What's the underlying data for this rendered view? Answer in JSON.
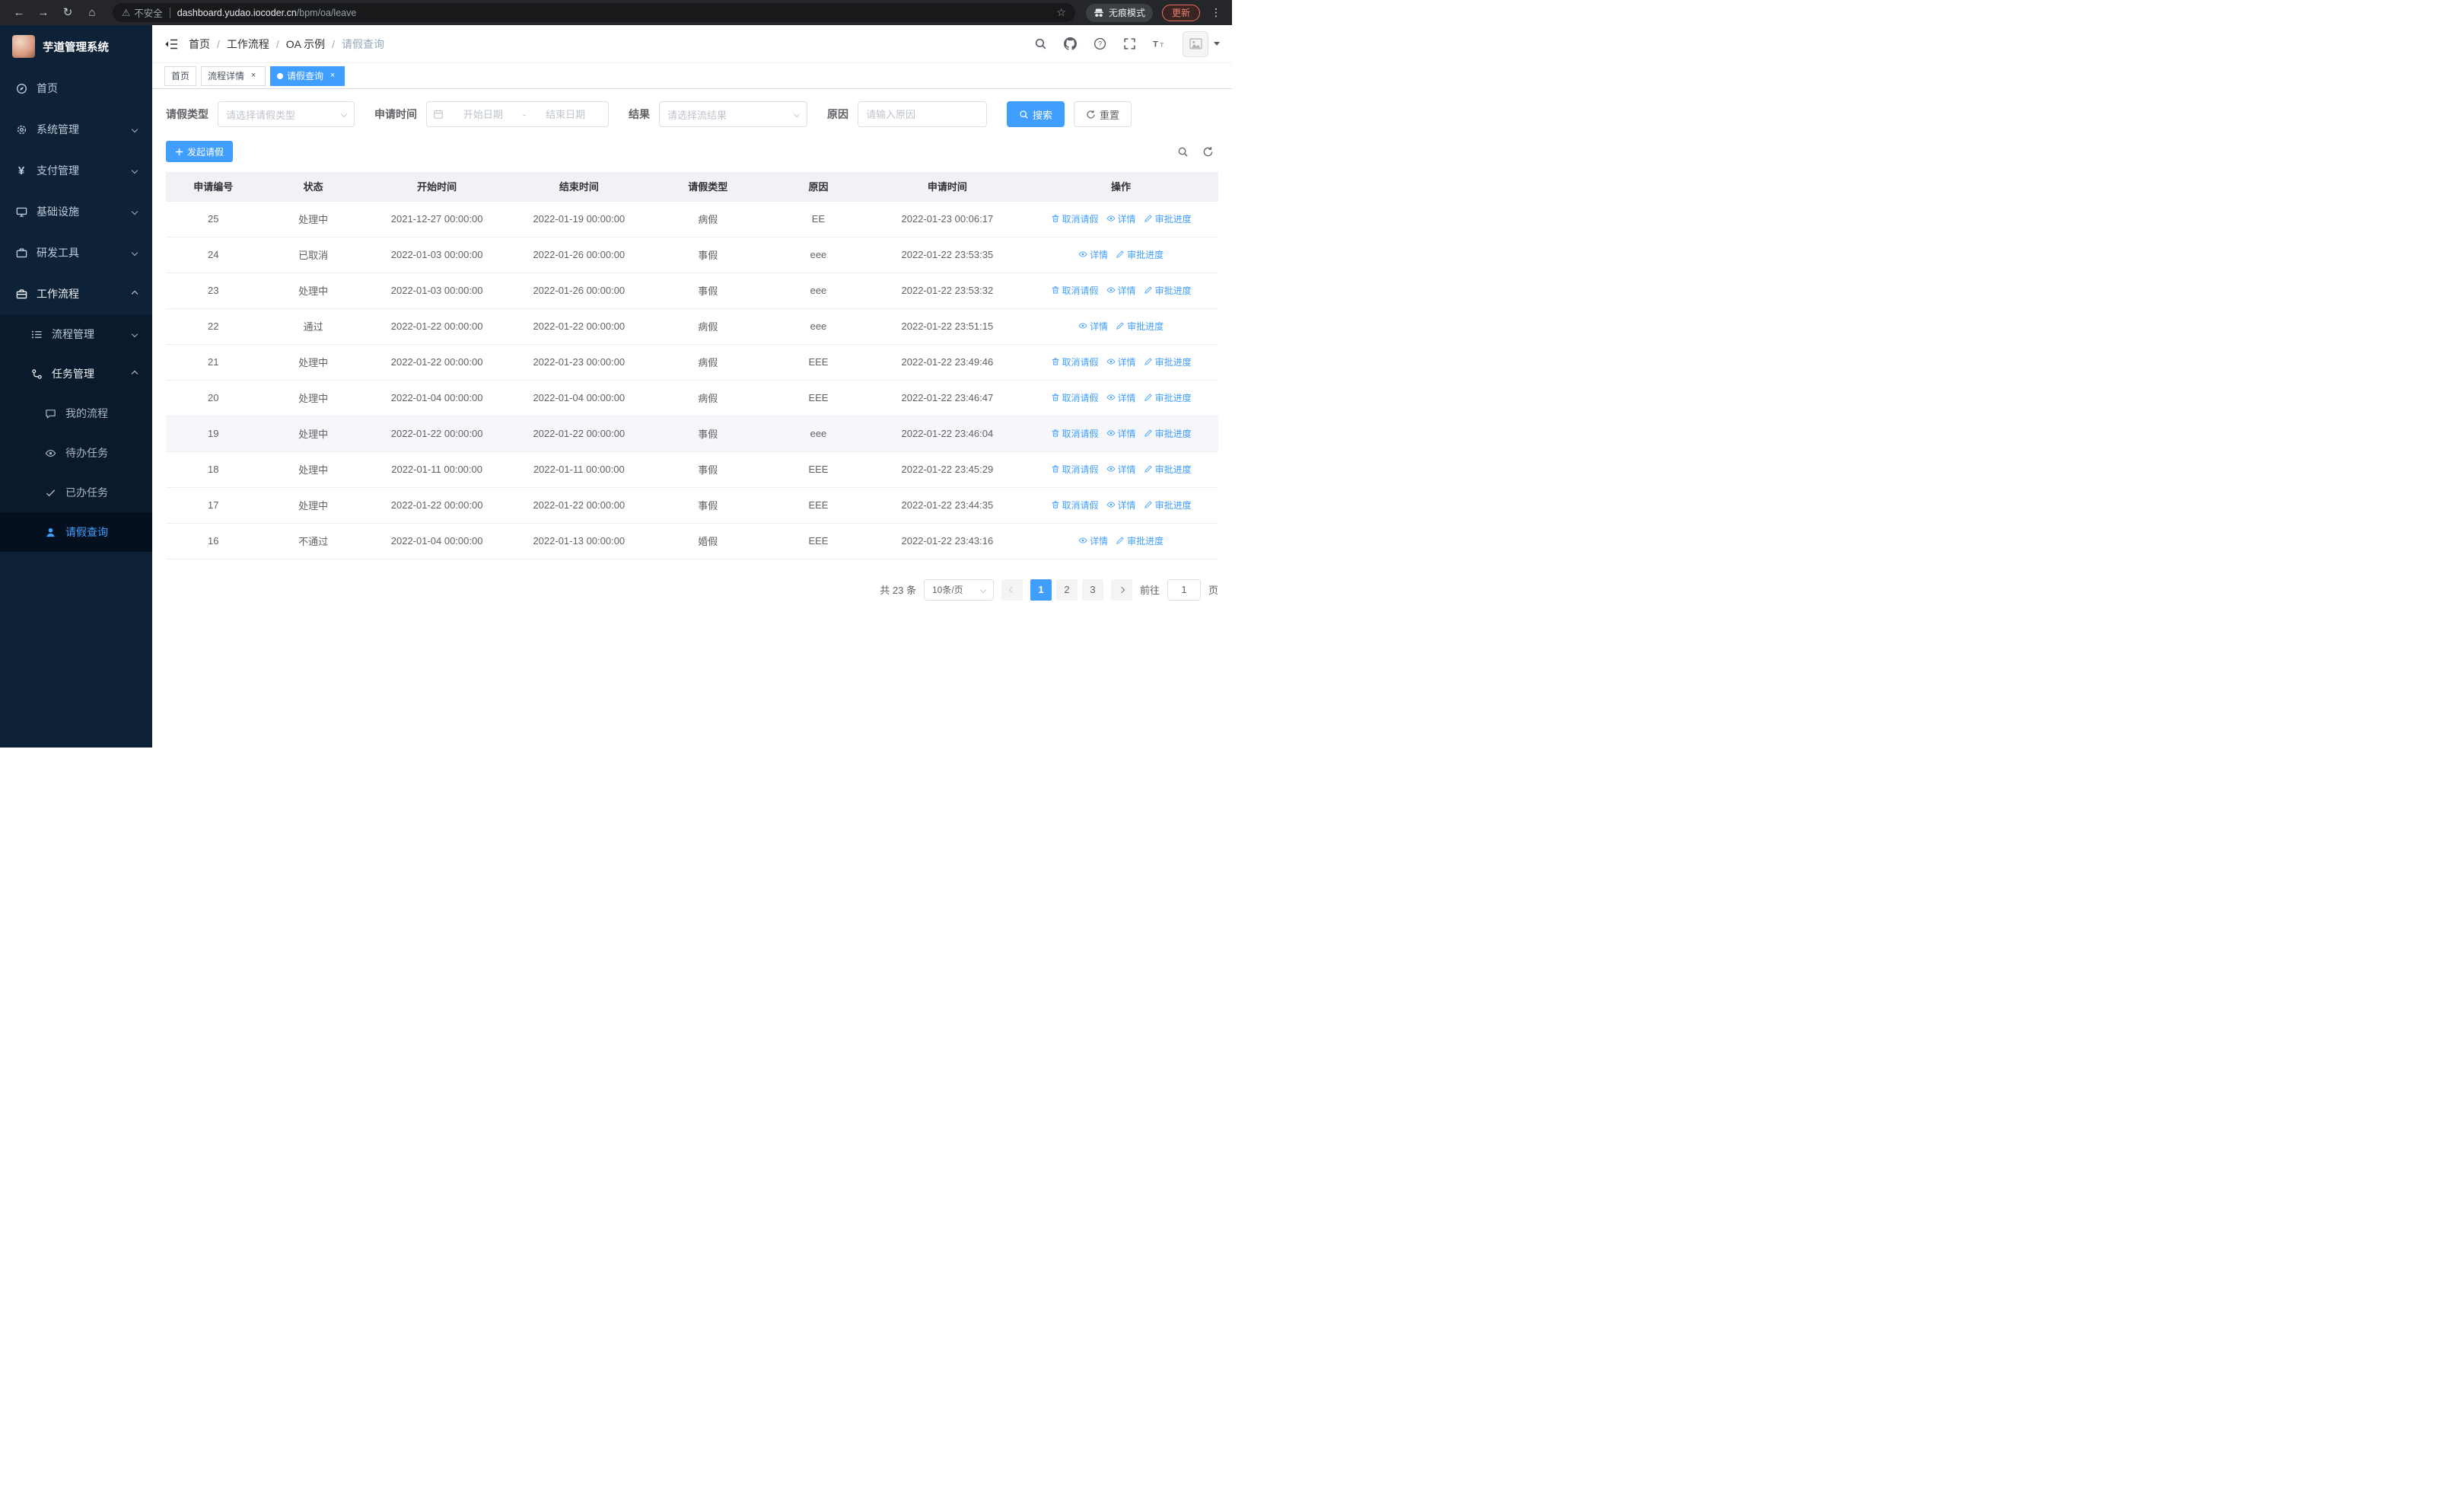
{
  "browser": {
    "security_label": "不安全",
    "url_domain": "dashboard.yudao.iocoder.cn",
    "url_path": "/bpm/oa/leave",
    "incognito_label": "无痕模式",
    "update_label": "更新"
  },
  "sidebar": {
    "app_title": "芋道管理系统",
    "items": [
      "首页",
      "系统管理",
      "支付管理",
      "基础设施",
      "研发工具",
      "工作流程",
      "流程管理",
      "任务管理",
      "我的流程",
      "待办任务",
      "已办任务",
      "请假查询"
    ]
  },
  "breadcrumb": [
    "首页",
    "工作流程",
    "OA 示例",
    "请假查询"
  ],
  "tabs": [
    "首页",
    "流程详情",
    "请假查询"
  ],
  "filters": {
    "leave_type_label": "请假类型",
    "leave_type_placeholder": "请选择请假类型",
    "apply_time_label": "申请时间",
    "start_date_placeholder": "开始日期",
    "range_separator": "-",
    "end_date_placeholder": "结束日期",
    "result_label": "结果",
    "result_placeholder": "请选择流结果",
    "reason_label": "原因",
    "reason_placeholder": "请输入原因",
    "search_button": "搜索",
    "reset_button": "重置"
  },
  "toolbar": {
    "create_button": "发起请假"
  },
  "table": {
    "headers": [
      "申请编号",
      "状态",
      "开始时间",
      "结束时间",
      "请假类型",
      "原因",
      "申请时间",
      "操作"
    ],
    "action_labels": {
      "cancel": "取消请假",
      "detail": "详情",
      "progress": "审批进度"
    },
    "rows": [
      {
        "id": "25",
        "status": "处理中",
        "start": "2021-12-27 00:00:00",
        "end": "2022-01-19 00:00:00",
        "type": "病假",
        "reason": "EE",
        "apply_time": "2022-01-23 00:06:17",
        "actions": [
          "cancel",
          "detail",
          "progress"
        ],
        "highlight": false
      },
      {
        "id": "24",
        "status": "已取消",
        "start": "2022-01-03 00:00:00",
        "end": "2022-01-26 00:00:00",
        "type": "事假",
        "reason": "eee",
        "apply_time": "2022-01-22 23:53:35",
        "actions": [
          "detail",
          "progress"
        ],
        "highlight": false
      },
      {
        "id": "23",
        "status": "处理中",
        "start": "2022-01-03 00:00:00",
        "end": "2022-01-26 00:00:00",
        "type": "事假",
        "reason": "eee",
        "apply_time": "2022-01-22 23:53:32",
        "actions": [
          "cancel",
          "detail",
          "progress"
        ],
        "highlight": false
      },
      {
        "id": "22",
        "status": "通过",
        "start": "2022-01-22 00:00:00",
        "end": "2022-01-22 00:00:00",
        "type": "病假",
        "reason": "eee",
        "apply_time": "2022-01-22 23:51:15",
        "actions": [
          "detail",
          "progress"
        ],
        "highlight": false
      },
      {
        "id": "21",
        "status": "处理中",
        "start": "2022-01-22 00:00:00",
        "end": "2022-01-23 00:00:00",
        "type": "病假",
        "reason": "EEE",
        "apply_time": "2022-01-22 23:49:46",
        "actions": [
          "cancel",
          "detail",
          "progress"
        ],
        "highlight": false
      },
      {
        "id": "20",
        "status": "处理中",
        "start": "2022-01-04 00:00:00",
        "end": "2022-01-04 00:00:00",
        "type": "病假",
        "reason": "EEE",
        "apply_time": "2022-01-22 23:46:47",
        "actions": [
          "cancel",
          "detail",
          "progress"
        ],
        "highlight": false
      },
      {
        "id": "19",
        "status": "处理中",
        "start": "2022-01-22 00:00:00",
        "end": "2022-01-22 00:00:00",
        "type": "事假",
        "reason": "eee",
        "apply_time": "2022-01-22 23:46:04",
        "actions": [
          "cancel",
          "detail",
          "progress"
        ],
        "highlight": true
      },
      {
        "id": "18",
        "status": "处理中",
        "start": "2022-01-11 00:00:00",
        "end": "2022-01-11 00:00:00",
        "type": "事假",
        "reason": "EEE",
        "apply_time": "2022-01-22 23:45:29",
        "actions": [
          "cancel",
          "detail",
          "progress"
        ],
        "highlight": false
      },
      {
        "id": "17",
        "status": "处理中",
        "start": "2022-01-22 00:00:00",
        "end": "2022-01-22 00:00:00",
        "type": "事假",
        "reason": "EEE",
        "apply_time": "2022-01-22 23:44:35",
        "actions": [
          "cancel",
          "detail",
          "progress"
        ],
        "highlight": false
      },
      {
        "id": "16",
        "status": "不通过",
        "start": "2022-01-04 00:00:00",
        "end": "2022-01-13 00:00:00",
        "type": "婚假",
        "reason": "EEE",
        "apply_time": "2022-01-22 23:43:16",
        "actions": [
          "detail",
          "progress"
        ],
        "highlight": false
      }
    ]
  },
  "pagination": {
    "total_text": "共 23 条",
    "page_size": "10条/页",
    "pages": [
      "1",
      "2",
      "3"
    ],
    "active_page": "1",
    "goto_label": "前往",
    "goto_value": "1",
    "page_unit": "页"
  },
  "colors": {
    "primary": "#409eff",
    "sidebar_bg": "#0e2237",
    "sidebar_sub_bg": "#081a2c"
  }
}
